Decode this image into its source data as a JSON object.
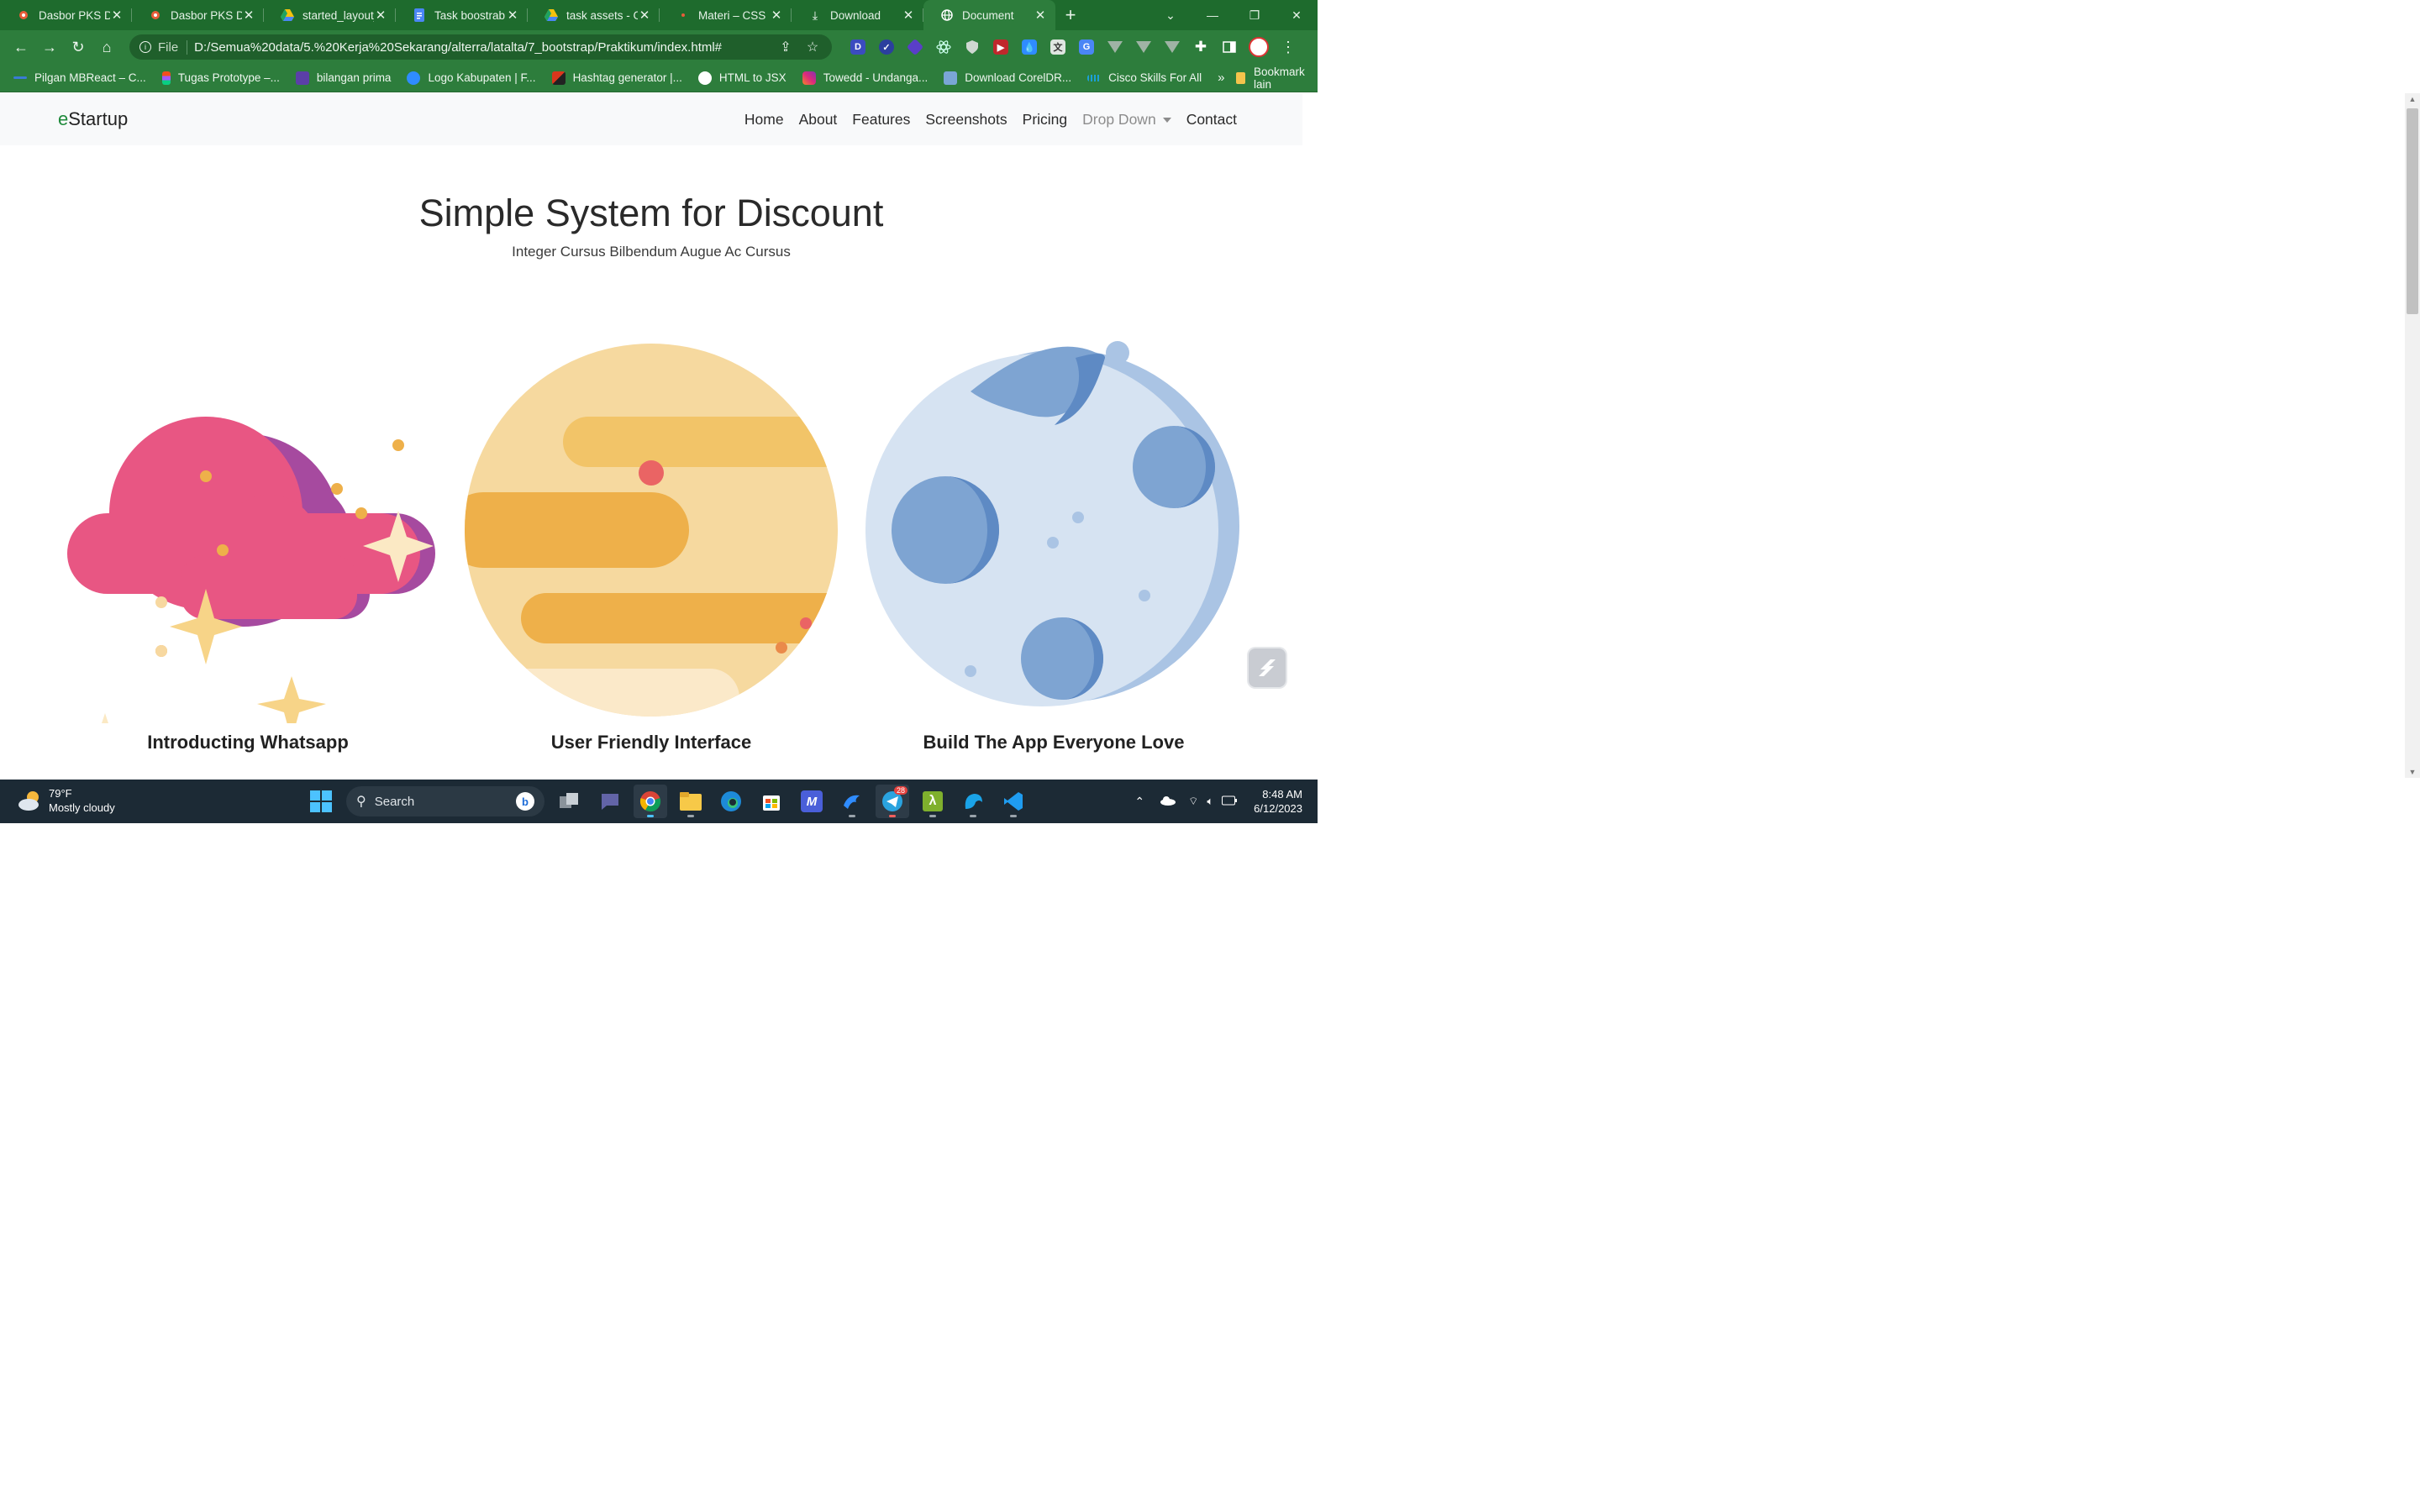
{
  "browser": {
    "tabs": [
      {
        "title": "Dasbor PKS Digital",
        "icon": "figma-style-icon",
        "color": "#e85c3a"
      },
      {
        "title": "Dasbor PKS Digital",
        "icon": "figma-style-icon",
        "color": "#e85c3a"
      },
      {
        "title": "started_layout_",
        "icon": "drive-icon",
        "color": "#f4c20d"
      },
      {
        "title": "Task boostrab",
        "icon": "docs-icon",
        "color": "#4a86f5"
      },
      {
        "title": "task assets - Go",
        "icon": "drive-icon",
        "color": "#f4c20d"
      },
      {
        "title": "Materi – CSS",
        "icon": "dot-icon",
        "color": "#e85c3a"
      },
      {
        "title": "Download",
        "icon": "download-icon",
        "color": "#ffffff"
      },
      {
        "title": "Document",
        "icon": "globe-icon",
        "color": "#ffffff",
        "active": true
      }
    ],
    "address": {
      "scheme_label": "File",
      "url": "D:/Semua%20data/5.%20Kerja%20Sekarang/alterra/latalta/7_bootstrap/Praktikum/index.html#"
    },
    "bookmarks": [
      {
        "label": "Pilgan MBReact – C...",
        "color": "#3a7bd5"
      },
      {
        "label": "Tugas Prototype –...",
        "color": "#f24e1e"
      },
      {
        "label": "bilangan prima",
        "color": "#5b3fa8"
      },
      {
        "label": "Logo Kabupaten | F...",
        "color": "#2f8cff"
      },
      {
        "label": "Hashtag generator |...",
        "color": "#d9361c"
      },
      {
        "label": "HTML to JSX",
        "color": "#ffffff"
      },
      {
        "label": "Towedd - Undanga...",
        "color": "#e1306c"
      },
      {
        "label": "Download CorelDR...",
        "color": "#7aa6d6"
      },
      {
        "label": "Cisco Skills For All",
        "color": "#1ba0d7"
      }
    ],
    "bookmarks_more": "»",
    "bookmarks_folder": "Bookmark lain"
  },
  "site": {
    "brand": "eStartup",
    "nav": [
      "Home",
      "About",
      "Features",
      "Screenshots",
      "Pricing"
    ],
    "dropdown_label": "Drop Down",
    "contact_label": "Contact",
    "hero_title": "Simple System for Discount",
    "hero_subtitle": "Integer Cursus Bilbendum Augue Ac Cursus",
    "features": [
      {
        "title": "Introducting Whatsapp",
        "illustration": "pink-cloud-illustration"
      },
      {
        "title": "User Friendly Interface",
        "illustration": "yellow-planet-illustration"
      },
      {
        "title": "Build The App Everyone Love",
        "illustration": "blue-moon-illustration"
      }
    ]
  },
  "taskbar": {
    "weather_temp": "79°F",
    "weather_desc": "Mostly cloudy",
    "search_label": "Search",
    "telegram_badge": "28",
    "time": "8:48 AM",
    "date": "6/12/2023"
  }
}
